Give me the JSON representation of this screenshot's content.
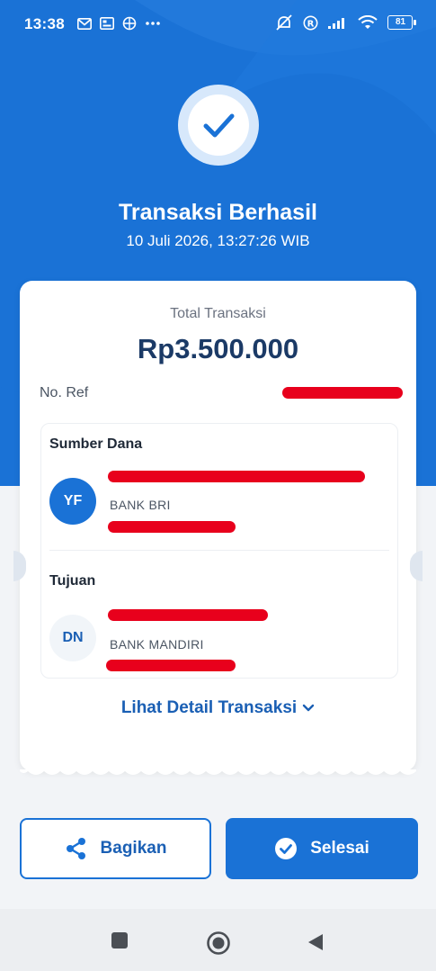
{
  "status_bar": {
    "time": "13:38",
    "battery": "81",
    "icons": [
      "gmail-icon",
      "gallery-icon",
      "vpn-icon",
      "more-dots-icon",
      "mute-icon",
      "registered-icon",
      "signal-icon",
      "wifi-icon",
      "battery-icon"
    ]
  },
  "header": {
    "status_icon": "check-icon",
    "title": "Transaksi Berhasil",
    "datetime": "10 Juli 2026, 13:27:26 WIB"
  },
  "receipt": {
    "total_label": "Total Transaksi",
    "total_amount": "Rp3.500.000",
    "ref_label": "No. Ref",
    "source": {
      "section_title": "Sumber Dana",
      "initials": "YF",
      "bank": "BANK BRI"
    },
    "destination": {
      "section_title": "Tujuan",
      "initials": "DN",
      "bank": "BANK MANDIRI"
    },
    "detail_link": "Lihat Detail Transaksi"
  },
  "actions": {
    "share_label": "Bagikan",
    "done_label": "Selesai"
  },
  "colors": {
    "primary": "#1a72d6",
    "redaction": "#e8001c",
    "amount": "#1b3a66"
  }
}
